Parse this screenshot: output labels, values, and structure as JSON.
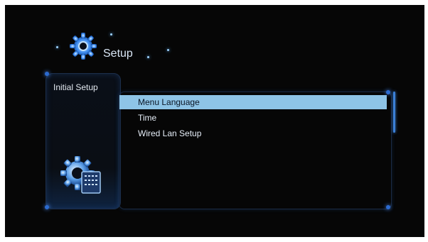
{
  "header": {
    "title": "Setup",
    "icon": "gear-icon"
  },
  "sidebar": {
    "label": "Initial Setup",
    "icon": "settings-document-icon"
  },
  "menu": {
    "items": [
      {
        "label": "Menu Language",
        "selected": true
      },
      {
        "label": "Time",
        "selected": false
      },
      {
        "label": "Wired Lan Setup",
        "selected": false
      }
    ]
  },
  "colors": {
    "highlight": "#8ec4e6",
    "accent": "#3b7fd6",
    "background": "#060606"
  }
}
